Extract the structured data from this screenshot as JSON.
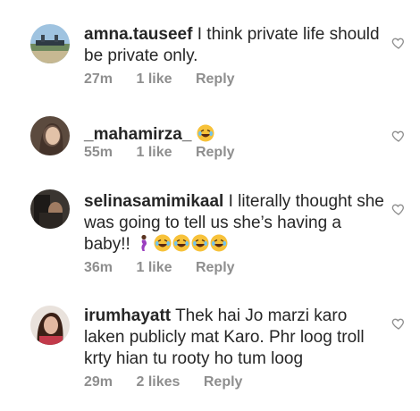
{
  "comments": [
    {
      "username": "amna.tauseef",
      "text": "I think private life should be private only.",
      "time": "27m",
      "likes": "1 like",
      "reply": "Reply",
      "emoji": []
    },
    {
      "username": "_mahamirza_",
      "text": "",
      "time": "55m",
      "likes": "1 like",
      "reply": "Reply",
      "emoji": [
        "laughing-face"
      ]
    },
    {
      "username": "selinasamimikaal",
      "text": "I literally thought she was going to tell us she’s having a baby!!",
      "time": "36m",
      "likes": "1 like",
      "reply": "Reply",
      "emoji": [
        "pregnant-woman",
        "laughing-face",
        "laughing-face",
        "laughing-face",
        "laughing-face"
      ]
    },
    {
      "username": "irumhayatt",
      "text": "Thek hai Jo marzi karo laken publicly mat Karo. Phr loog troll krty hian tu rooty ho tum loog",
      "time": "29m",
      "likes": "2 likes",
      "reply": "Reply",
      "emoji": []
    }
  ],
  "colors": {
    "primary_text": "#262626",
    "secondary_text": "#8e8e8e",
    "heart_outline": "#8e8e8e"
  },
  "icons": {
    "like": "heart-outline-icon"
  }
}
